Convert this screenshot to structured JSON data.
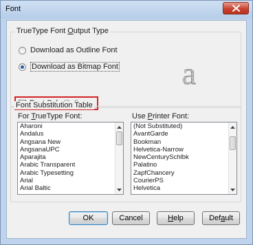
{
  "window": {
    "title": "Font"
  },
  "output_group": {
    "legend_pre": "TrueType Font ",
    "legend_ul": "O",
    "legend_post": "utput Type",
    "radio_outline": {
      "label": "Download as Outline Font",
      "selected": false
    },
    "radio_bitmap": {
      "label": "Download as Bitmap Font",
      "selected": true
    },
    "preview_glyph": "a"
  },
  "font_substitution": {
    "pre": "Font ",
    "ul": "S",
    "post": "ubstitution",
    "checked": true
  },
  "table_group": {
    "legend": "Font Substitution Table",
    "left_label_pre": "For ",
    "left_label_ul": "T",
    "left_label_post": "rueType Font:",
    "right_label_pre": "Use ",
    "right_label_ul": "P",
    "right_label_post": "rinter Font:",
    "truetype_fonts": [
      "Aharoni",
      "Andalus",
      "Angsana New",
      "AngsanaUPC",
      "Aparajita",
      "Arabic Transparent",
      "Arabic Typesetting",
      "Arial",
      "Arial Baltic"
    ],
    "printer_fonts": [
      "(Not Substituted)",
      "AvantGarde",
      "Bookman",
      "Helvetica-Narrow",
      "NewCenturySchlbk",
      "Palatino",
      "ZapfChancery",
      "CourierPS",
      "Helvetica"
    ]
  },
  "buttons": {
    "ok": "OK",
    "cancel": "Cancel",
    "help_ul": "H",
    "help_post": "elp",
    "default_pre": "Def",
    "default_ul": "a",
    "default_post": "ult"
  },
  "colors": {
    "highlight_box": "#d32424",
    "title_bg": "#c4d8ee",
    "close_button": "#c7432f"
  }
}
